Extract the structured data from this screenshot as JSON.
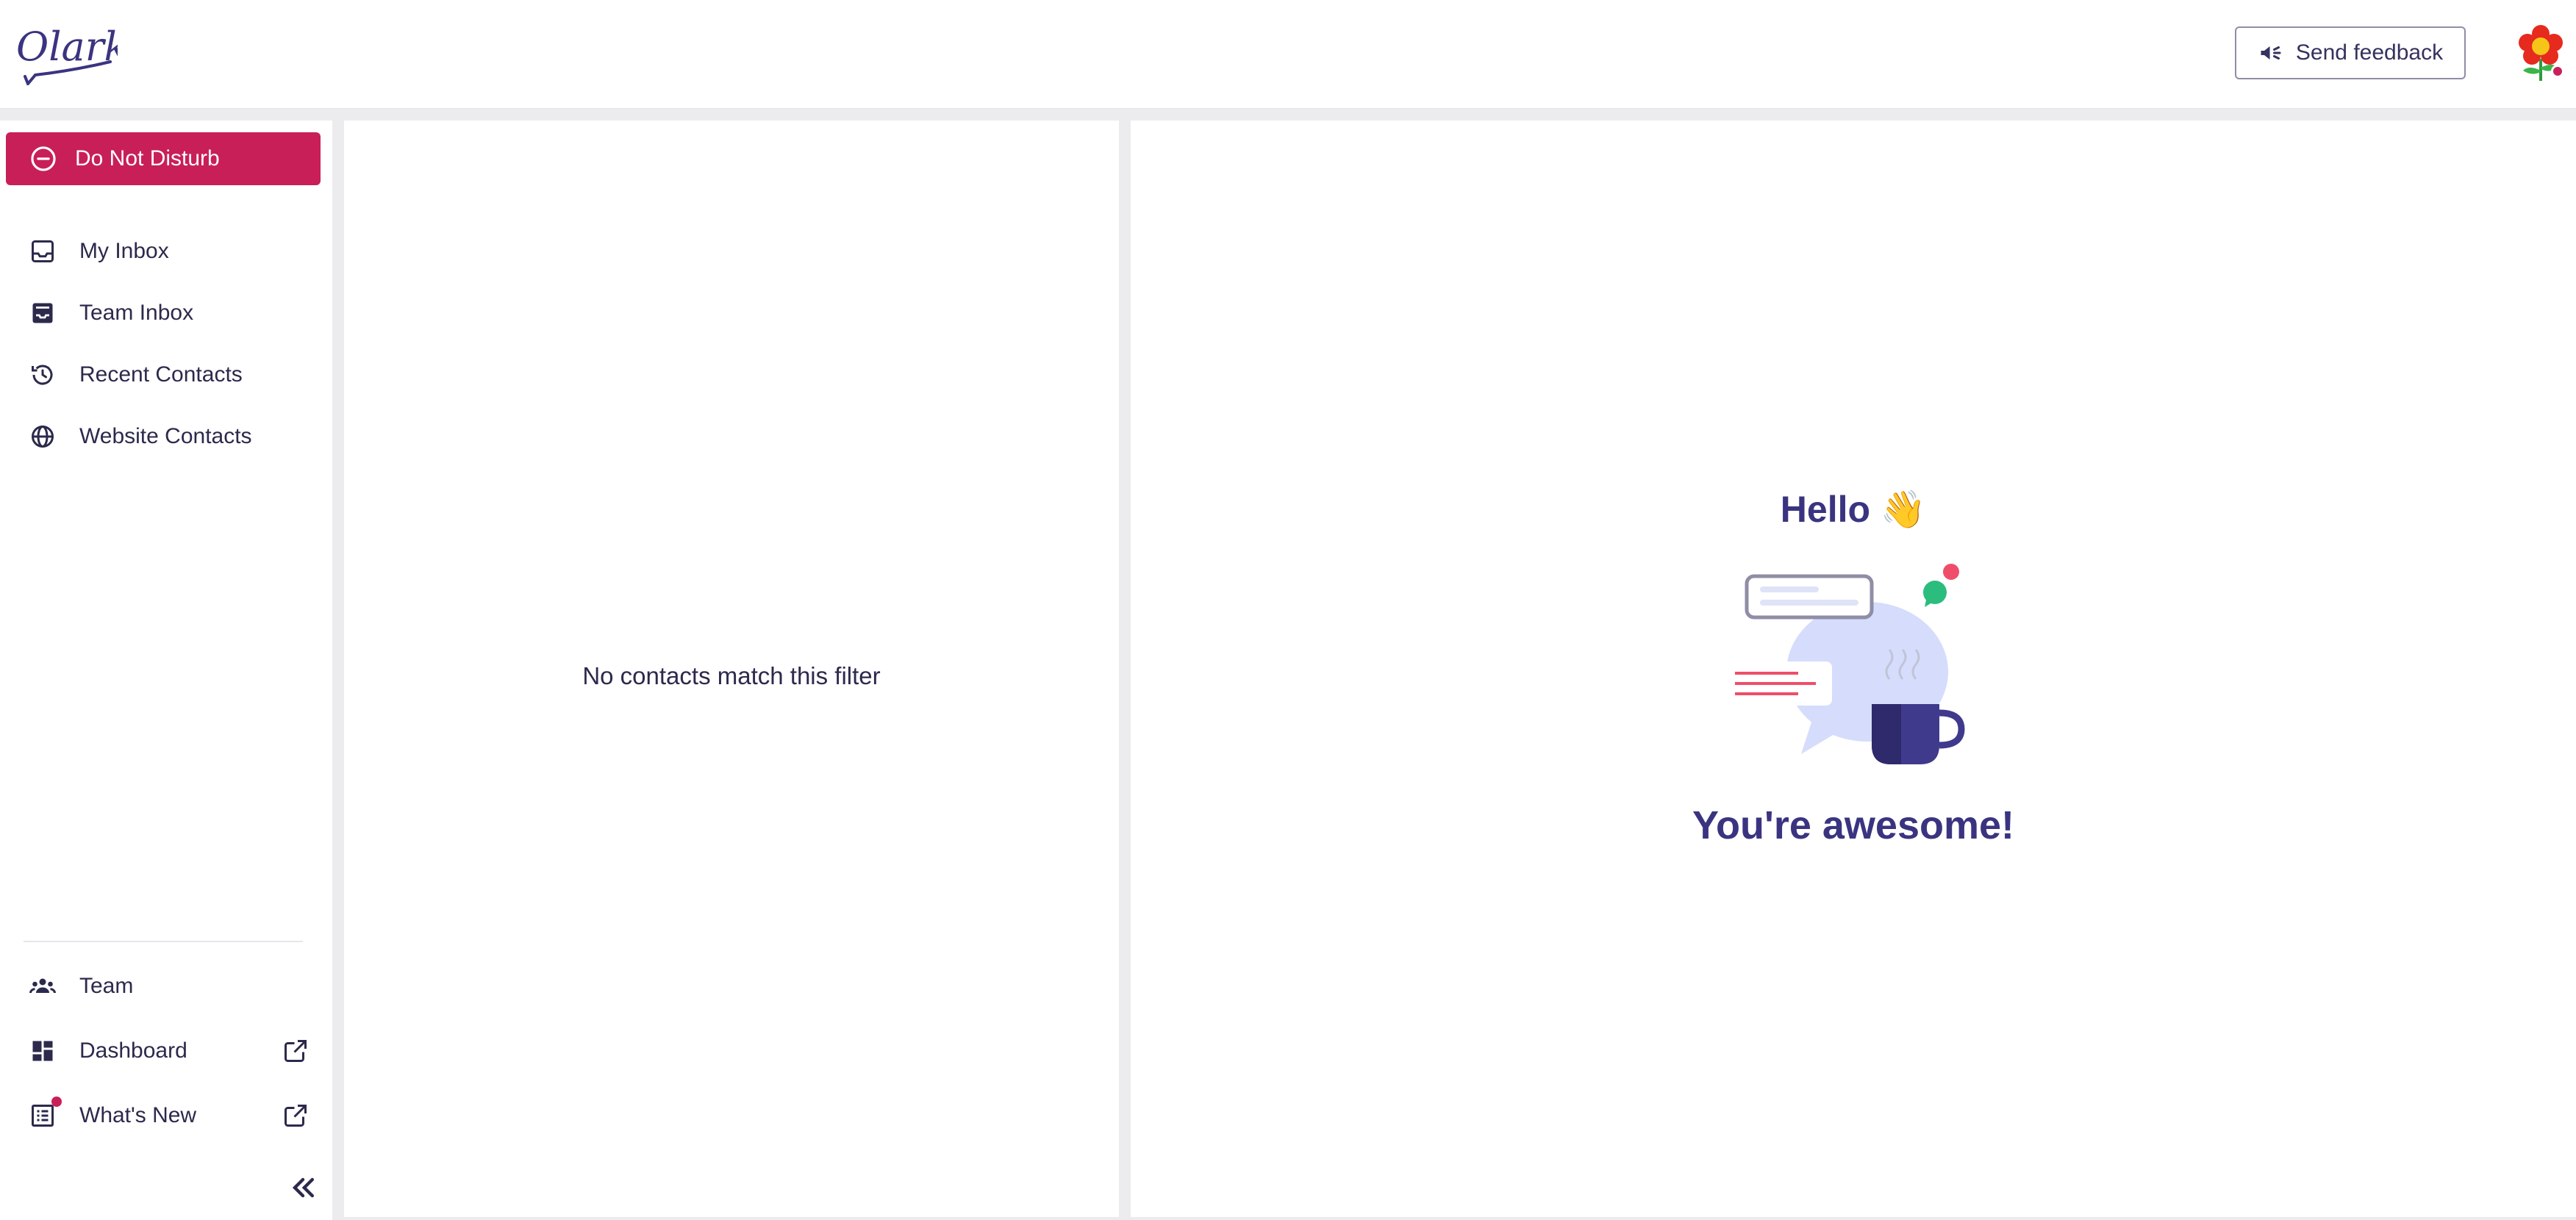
{
  "app": {
    "logo_text": "Olark",
    "send_feedback_label": "Send feedback"
  },
  "sidebar": {
    "status_button_label": "Do Not Disturb",
    "nav": [
      {
        "label": "My Inbox",
        "icon": "inbox-icon"
      },
      {
        "label": "Team Inbox",
        "icon": "team-inbox-icon"
      },
      {
        "label": "Recent Contacts",
        "icon": "history-icon"
      },
      {
        "label": "Website Contacts",
        "icon": "globe-icon"
      }
    ],
    "bottom_nav": [
      {
        "label": "Team",
        "icon": "team-icon"
      },
      {
        "label": "Dashboard",
        "icon": "dashboard-icon",
        "external": true
      },
      {
        "label": "What's New",
        "icon": "news-icon",
        "external": true,
        "has_badge": true
      }
    ]
  },
  "contacts_list": {
    "empty_message": "No contacts match this filter"
  },
  "welcome": {
    "greeting": "Hello 👋",
    "message": "You're awesome!"
  },
  "colors": {
    "accent": "#c81f59",
    "brand": "#3a3480"
  }
}
